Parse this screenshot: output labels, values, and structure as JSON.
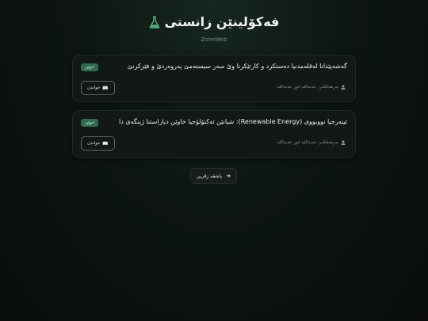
{
  "header": {
    "title": "فەکۆلینێن زانستی",
    "subtitle": "ZoneWeb",
    "icon": "flask-icon"
  },
  "articles": [
    {
      "title": "گەشەپێدانا لەقلەمدنیا دەستکرد و کارتێکرنا وێ سەر سیستەمێ پەروەردێ و فێرکرنێ",
      "badge": "خوێن",
      "author": "بەرهەڤکەر: عەبداللە انور عەبداللە",
      "read_label": "خواندن"
    },
    {
      "title": "ئینەرجیا نووبووی (Renewable Energy): شیانێن تەکنۆلۆجیا خاوێن دپاراستنا ژینگەی دا",
      "badge": "خوێن",
      "author": "بەرهەڤکەر: عەبداللە انور عەبداللە",
      "read_label": "خواندن"
    }
  ],
  "back_button": {
    "label": "پاشڤە زڤرین"
  },
  "colors": {
    "accent": "#2e6a4f",
    "flask": "#4fa077",
    "background": "#0d1512"
  }
}
